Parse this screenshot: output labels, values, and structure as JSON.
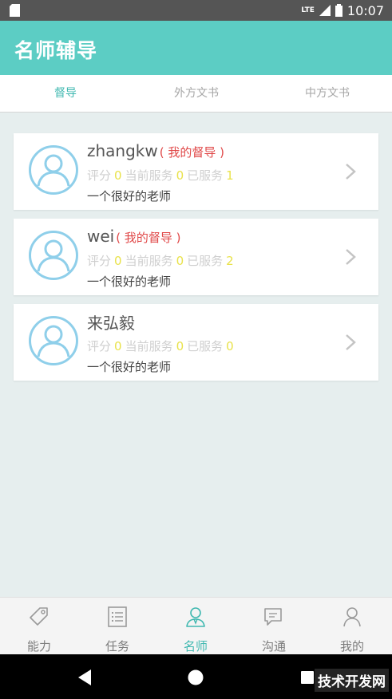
{
  "statusbar": {
    "network": "LTE",
    "time": "10:07"
  },
  "appbar": {
    "title": "名师辅导"
  },
  "tabs": [
    {
      "label": "督导",
      "active": true
    },
    {
      "label": "外方文书",
      "active": false
    },
    {
      "label": "中方文书",
      "active": false
    }
  ],
  "stat_labels": {
    "rating": "评分",
    "current": "当前服务",
    "served": "已服务"
  },
  "teachers": [
    {
      "name": "zhangkw",
      "tag": "( 我的督导 )",
      "rating": "0",
      "current": "0",
      "served": "1",
      "desc": "一个很好的老师"
    },
    {
      "name": "wei",
      "tag": "( 我的督导 )",
      "rating": "0",
      "current": "0",
      "served": "2",
      "desc": "一个很好的老师"
    },
    {
      "name": "来弘毅",
      "tag": "",
      "rating": "0",
      "current": "0",
      "served": "0",
      "desc": "一个很好的老师"
    }
  ],
  "bottom_nav": [
    {
      "label": "能力",
      "icon": "tag-icon",
      "active": false
    },
    {
      "label": "任务",
      "icon": "list-icon",
      "active": false
    },
    {
      "label": "名师",
      "icon": "teacher-icon",
      "active": true
    },
    {
      "label": "沟通",
      "icon": "chat-icon",
      "active": false
    },
    {
      "label": "我的",
      "icon": "person-icon",
      "active": false
    }
  ],
  "watermark": "技术开发网",
  "colors": {
    "primary": "#5ccdc4",
    "accent_text": "#3fb8b0",
    "tag_red": "#e04848",
    "number_yellow": "#e9e24a",
    "avatar_blue": "#8fcfea"
  }
}
